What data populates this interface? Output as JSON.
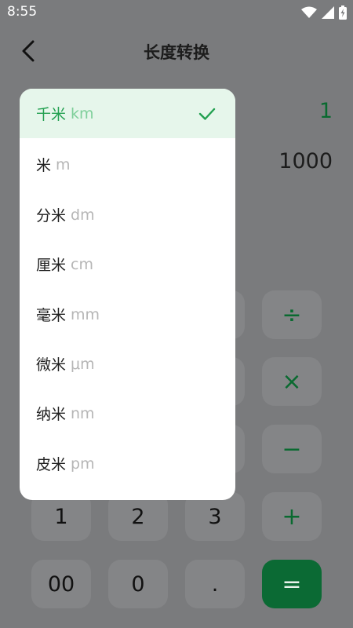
{
  "status_bar": {
    "time": "8:55"
  },
  "header": {
    "title": "长度转换",
    "back_icon": "chevron-left-icon"
  },
  "values": {
    "primary": "1",
    "secondary": "1000"
  },
  "keypad": {
    "divide": "÷",
    "multiply": "×",
    "minus": "−",
    "plus": "+",
    "one": "1",
    "two": "2",
    "three": "3",
    "double_zero": "00",
    "zero": "0",
    "dot": ".",
    "equals": "="
  },
  "dropdown": {
    "items": [
      {
        "name": "千米",
        "abbr": "km",
        "selected": true
      },
      {
        "name": "米",
        "abbr": "m"
      },
      {
        "name": "分米",
        "abbr": "dm"
      },
      {
        "name": "厘米",
        "abbr": "cm"
      },
      {
        "name": "毫米",
        "abbr": "mm"
      },
      {
        "name": "微米",
        "abbr": "μm"
      },
      {
        "name": "纳米",
        "abbr": "nm"
      },
      {
        "name": "皮米",
        "abbr": "pm"
      }
    ]
  },
  "colors": {
    "accent_green": "#22a050",
    "equals_button": "#0b6a34",
    "overlay_bg": "#7a7b7d"
  }
}
